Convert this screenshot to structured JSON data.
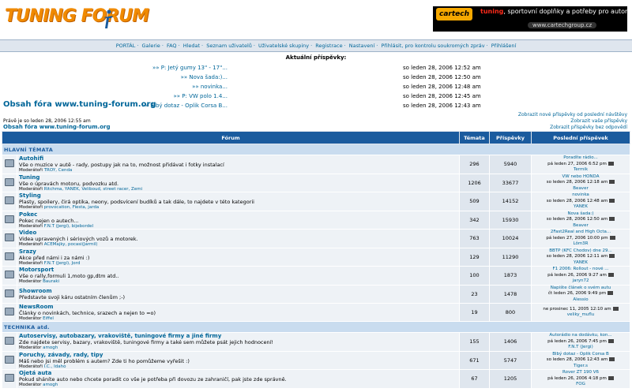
{
  "header": {
    "logo_text": "TUNING FORUM",
    "banner_badge": "cartech",
    "banner_tuning": "tuning",
    "banner_text": ", sportovní doplňky a potřeby pro automobily",
    "banner_url": "www.cartechgroup.cz"
  },
  "nav": {
    "items": [
      "PORTÁL",
      "Galerie",
      "FAQ",
      "Hledat",
      "Seznam uživatelů",
      "Uživatelské skupiny",
      "Registrace",
      "Nastavení",
      "Přihlásit, pro kontrolu soukromých zpráv",
      "Přihlášení"
    ]
  },
  "latest": {
    "title": "Aktuální příspěvky:",
    "items": [
      {
        "title": "»» P: Jetý gumy 13\" - 17\"...",
        "date": "so leden 28, 2006 12:52 am"
      },
      {
        "title": "»» Nova šada:)...",
        "date": "so leden 28, 2006 12:50 am"
      },
      {
        "title": "»» novinka...",
        "date": "so leden 28, 2006 12:48 am"
      },
      {
        "title": "»» P: VW polo 1.4...",
        "date": "so leden 28, 2006 12:45 am"
      },
      {
        "title": "»» Blbý dotaz - Oplik Corsa B...",
        "date": "so leden 28, 2006 12:43 am"
      }
    ]
  },
  "index": {
    "title": "Obsah fóra www.tuning-forum.org",
    "now": "Právě je so leden 28, 2006 12:55 am",
    "title_small": "Obsah fóra www.tuning-forum.org",
    "links": [
      "Zobrazit nové příspěvky od poslední návštěvy",
      "Zobrazit vaše příspěvky",
      "Zobrazit příspěvky bez odpovědí"
    ]
  },
  "table": {
    "headers": [
      "Fórum",
      "Témata",
      "Příspěvky",
      "Poslední příspěvek"
    ],
    "cat1": "HLAVNÍ TÉMATA",
    "cat2": "TECHNIKA atd.",
    "rows1": [
      {
        "name": "Autohifi",
        "desc": "Vše o muzice v autě - rady, postupy jak na to, možnost přidávat i fotky instalací",
        "mod_label": "Moderátoři",
        "mods": "TROY, Cenda",
        "topics": "296",
        "posts": "5940",
        "lp_title": "Poradíte rádio...",
        "lp_date": "pá leden 27, 2006 6:52 pm",
        "lp_user": "Termik"
      },
      {
        "name": "Tuning",
        "desc": "Vše o úpravách motoru, podvozku atd.",
        "mod_label": "Moderátoři",
        "mods": "Ritchma, YANEK, Veliboud, street racer, Zemi",
        "topics": "1206",
        "posts": "33677",
        "lp_title": "VW nebo HONDA",
        "lp_date": "so leden 28, 2006 12:18 am",
        "lp_user": "Beaver"
      },
      {
        "name": "Styling",
        "desc": "Plasty, spoilery, čirá optika, neony, podsvícení budíků a tak dále, to najdete v této kategorii",
        "mod_label": "Moderátoři",
        "mods": "provocation, Fiesta, jarda",
        "topics": "509",
        "posts": "14152",
        "lp_title": "novinka",
        "lp_date": "so leden 28, 2006 12:48 am",
        "lp_user": "YANEK"
      },
      {
        "name": "Pokec",
        "desc": "Pokec nejen o autech...",
        "mod_label": "Moderátoři",
        "mods": "F.N.T (Jergi), bijebordel",
        "topics": "342",
        "posts": "15930",
        "lp_title": "Nova šada:)",
        "lp_date": "so leden 28, 2006 12:50 am",
        "lp_user": "Beaver"
      },
      {
        "name": "Video",
        "desc": "Videa upravených i sériových vozů a motorek.",
        "mod_label": "Moderátoři",
        "mods": "ACEMajky, pocasi(Jarmil)",
        "topics": "763",
        "posts": "10024",
        "lp_title": "2Fast2Real and High Octa...",
        "lp_date": "pá leden 27, 2006 10:00 pm",
        "lp_user": "Lôm3R"
      },
      {
        "name": "Srazy",
        "desc": "Akce před námi i za námi :)",
        "mod_label": "Moderátoři",
        "mods": "F.N.T (Jergi), Jord",
        "topics": "129",
        "posts": "11290",
        "lp_title": "BBTP (KFC Chodov) dne 29...",
        "lp_date": "so leden 28, 2006 12:11 am",
        "lp_user": "YANEK"
      },
      {
        "name": "Motorsport",
        "desc": "Vše o rally,formuli 1,moto gp,dtm atd..",
        "mod_label": "Moderátor",
        "mods": "Bauraki",
        "topics": "100",
        "posts": "1873",
        "lp_title": "F1 2006: Rollout - nové ...",
        "lp_date": "pá leden 26, 2006 9:27 am",
        "lp_user": "jaryn72"
      },
      {
        "name": "Showroom",
        "desc": "Představte svoji káru ostatním členům ;-)",
        "mod_label": "",
        "mods": "",
        "topics": "23",
        "posts": "1478",
        "lp_title": "Napište článek o svém autu",
        "lp_date": "čt leden 26, 2006 9:49 pm",
        "lp_user": "Alessio"
      },
      {
        "name": "NewsRoom",
        "desc": "Články o novinkách, technice, srazech a nejen to =o)",
        "mod_label": "Moderátor",
        "mods": "Eiffel",
        "topics": "19",
        "posts": "800",
        "lp_title": "",
        "lp_date": "ne prosinec 11, 2005 12:10 am",
        "lp_user": "veliky_muflu"
      }
    ],
    "rows2": [
      {
        "name": "Autoservisy, autobazary, vrakoviště, tuningové firmy a jiné firmy",
        "desc": "Zde najdete servisy, bazary, vrakoviště, tuningové firmy a také sem můžete psát jejich hodnocení!",
        "mod_label": "Moderátor",
        "mods": "amogh",
        "topics": "155",
        "posts": "1406",
        "lp_title": "Autorádio na dodávku, kon...",
        "lp_date": "pá leden 26, 2006 7:45 pm",
        "lp_user": "F.N.T (Jergi)"
      },
      {
        "name": "Poruchy, závady, rady, tipy",
        "desc": "Máš nebo jsi měl problém s autem? Zde ti ho pomůžeme vyřešit :)",
        "mod_label": "Moderátoři",
        "mods": "I.C., Idaho",
        "topics": "671",
        "posts": "5747",
        "lp_title": "Blbý dotaz - Oplik Corsa B",
        "lp_date": "so leden 28, 2006 12:43 am",
        "lp_user": "Tiger.s"
      },
      {
        "name": "Ojetá auta",
        "desc": "Pokud sháníte auto nebo chcete poradit co vše je potřeba při dovozu ze zahraničí, pak jste zde správně.",
        "mod_label": "Moderátor",
        "mods": "amogh",
        "topics": "67",
        "posts": "1205",
        "lp_title": "Rover ZT 190 V6",
        "lp_date": "pá leden 26, 2006 4:18 pm",
        "lp_user": "FOG"
      }
    ]
  }
}
